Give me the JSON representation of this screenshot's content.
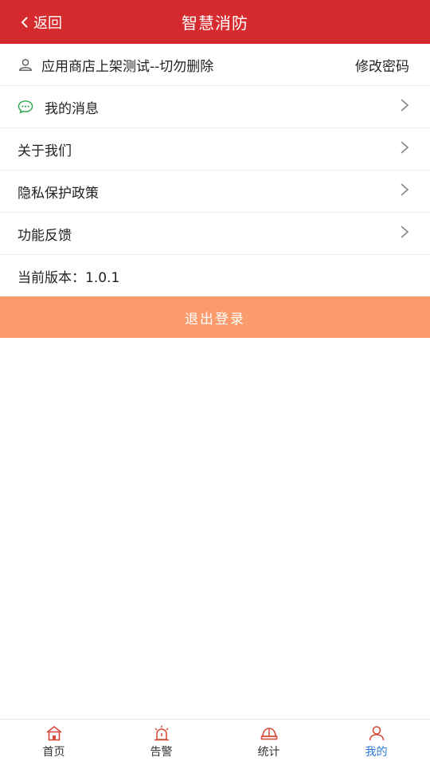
{
  "header": {
    "back_label": "返回",
    "title": "智慧消防"
  },
  "account": {
    "username": "应用商店上架测试--切勿删除",
    "change_password": "修改密码"
  },
  "menu": {
    "messages": "我的消息",
    "about": "关于我们",
    "privacy": "隐私保护政策",
    "feedback": "功能反馈",
    "version": "当前版本：1.0.1"
  },
  "logout_label": "退出登录",
  "tabs": [
    {
      "label": "首页",
      "icon": "home-icon"
    },
    {
      "label": "告警",
      "icon": "alarm-icon"
    },
    {
      "label": "统计",
      "icon": "helmet-icon"
    },
    {
      "label": "我的",
      "icon": "user-icon"
    }
  ],
  "colors": {
    "header": "#d62b2e",
    "logout": "#fb9a6b",
    "tab_active": "#2b7bd6",
    "message_icon": "#2aa84f",
    "tab_icon": "#d84a3a"
  }
}
